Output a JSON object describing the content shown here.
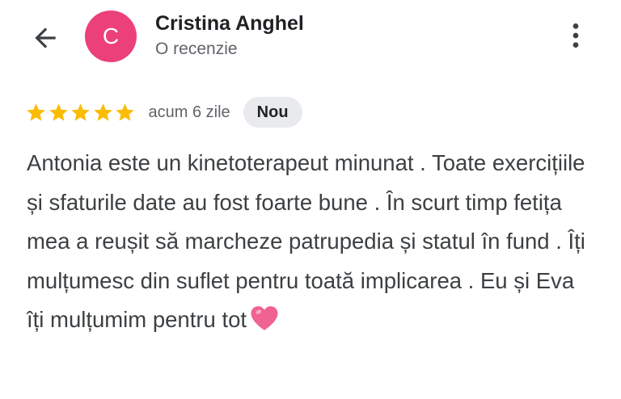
{
  "header": {
    "back_icon": "arrow-back-icon",
    "avatar_letter": "C",
    "avatar_color": "#EC407A",
    "author_name": "Cristina Anghel",
    "author_subtitle": "O recenzie",
    "more_icon": "more-vert-icon"
  },
  "review": {
    "rating": 5,
    "rating_max": 5,
    "star_color": "#FBBC04",
    "date": "acum 6 zile",
    "badge": "Nou",
    "text": "Antonia este un kinetoterapeut minunat . Toate exercițiile și sfaturile date au fost foarte bune . În scurt timp fetița mea a reușit să marcheze patrupedia și statul în fund . Îți mulțumesc din suflet pentru toată implicarea . Eu și Eva îți mulțumim pentru tot",
    "emoji": "heart-icon",
    "emoji_color": "#F06292"
  }
}
